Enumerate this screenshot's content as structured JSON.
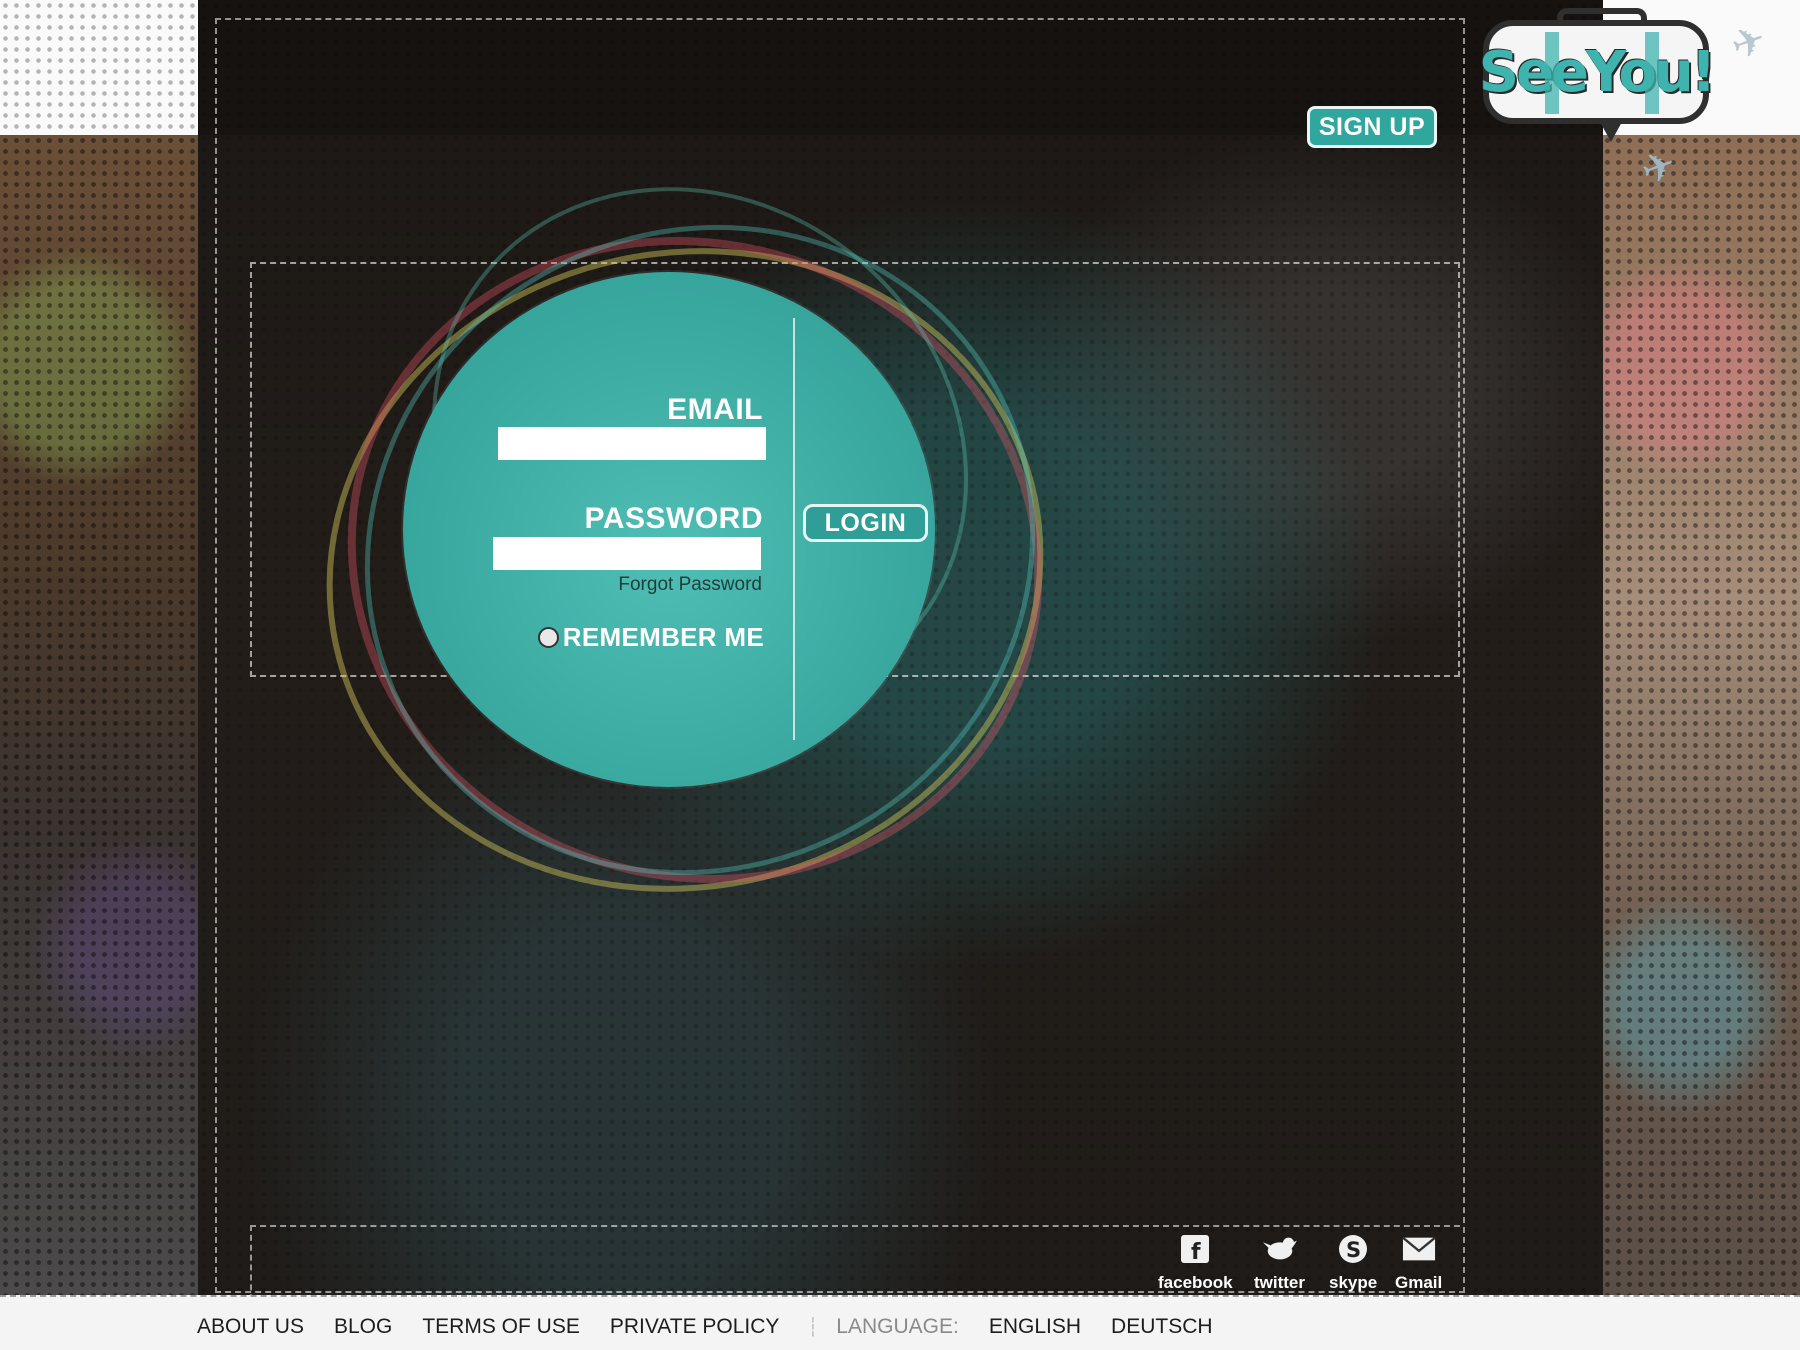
{
  "header": {
    "logo_text": "SeeYou!",
    "signup_label": "SIGN UP"
  },
  "login": {
    "email_label": "EMAIL",
    "email_value": "",
    "password_label": "PASSWORD",
    "password_value": "",
    "forgot_label": "Forgot Password",
    "remember_label": "REMEMBER ME",
    "login_label": "LOGIN"
  },
  "social": [
    {
      "label": "facebook",
      "icon": "facebook-icon"
    },
    {
      "label": "twitter",
      "icon": "twitter-icon"
    },
    {
      "label": "skype",
      "icon": "skype-icon"
    },
    {
      "label": "Gmail",
      "icon": "mail-icon"
    }
  ],
  "footer": {
    "links": [
      "ABOUT US",
      "BLOG",
      "TERMS OF USE",
      "PRIVATE POLICY"
    ],
    "language_label": "LANGUAGE:",
    "languages": [
      "ENGLISH",
      "DEUTSCH"
    ]
  },
  "colors": {
    "accent": "#3aa9a0",
    "panel": "#1f1b18",
    "footer_bg": "#f4f4f4"
  }
}
